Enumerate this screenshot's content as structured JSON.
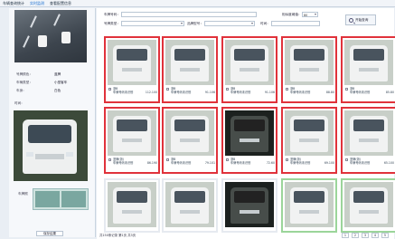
{
  "menu": [
    "车辆查询统计",
    "实时监测",
    "查看配置信息"
  ],
  "left": {
    "fields": [
      {
        "label": "号牌颜色：",
        "value": "蓝牌"
      },
      {
        "label": "车辆类型：",
        "value": "小型客车"
      },
      {
        "label": "车身：",
        "value": "白色"
      },
      {
        "label": "时间：",
        "value": "2015"
      }
    ],
    "extra_label": "年检标",
    "plate_label": "车牌照",
    "button": "保存结果"
  },
  "filters": {
    "plate_label": "车牌号码：",
    "type_label": "号牌类型：",
    "brand_label": "品牌型号：",
    "time_label": "时间：",
    "similarity_label": "相似度阈值：",
    "similarity_value": "80",
    "search_button": "开始查询"
  },
  "tiles": [
    {
      "type": "red",
      "dark": false,
      "line1": "浙B",
      "line2": "车牌号码未识别",
      "value": "112.100"
    },
    {
      "type": "red",
      "dark": false,
      "line1": "浙B",
      "line2": "车牌号码未识别",
      "value": "91.106"
    },
    {
      "type": "red",
      "dark": false,
      "line1": "浙B",
      "line2": "车牌号码未识别",
      "value": "91.106"
    },
    {
      "type": "red",
      "dark": false,
      "line1": "浙B",
      "line2": "车牌号码未识别",
      "value": "88.80"
    },
    {
      "type": "red",
      "dark": false,
      "line1": "浙B",
      "line2": "车牌号码未识别",
      "value": "85.80"
    },
    {
      "type": "red",
      "dark": false,
      "line1": "蓝牌(浙)",
      "line2": "车牌号码未识别",
      "value": "86.190"
    },
    {
      "type": "red",
      "dark": false,
      "line1": "浙B",
      "line2": "车牌号码未识别",
      "value": "79.101"
    },
    {
      "type": "red",
      "dark": true,
      "line1": "浙B",
      "line2": "车牌号码未识别",
      "value": "72.60"
    },
    {
      "type": "red",
      "dark": false,
      "line1": "蓝牌(浙)",
      "line2": "车牌号码未识别",
      "value": "69.100"
    },
    {
      "type": "red",
      "dark": false,
      "line1": "蓝牌(浙)",
      "line2": "车牌号码未识别",
      "value": "65.100"
    },
    {
      "type": "plain",
      "dark": false,
      "line1": "",
      "line2": "",
      "value": ""
    },
    {
      "type": "plain",
      "dark": false,
      "line1": "",
      "line2": "",
      "value": ""
    },
    {
      "type": "plain",
      "dark": true,
      "line1": "",
      "line2": "",
      "value": ""
    },
    {
      "type": "green",
      "dark": false,
      "line1": "",
      "line2": "",
      "value": ""
    },
    {
      "type": "green",
      "dark": false,
      "line1": "",
      "line2": "",
      "value": ""
    }
  ],
  "pager": {
    "summary": "共150条记录 第1页 共3页",
    "pages": [
      "1",
      "2",
      "3",
      "4",
      "5"
    ]
  }
}
